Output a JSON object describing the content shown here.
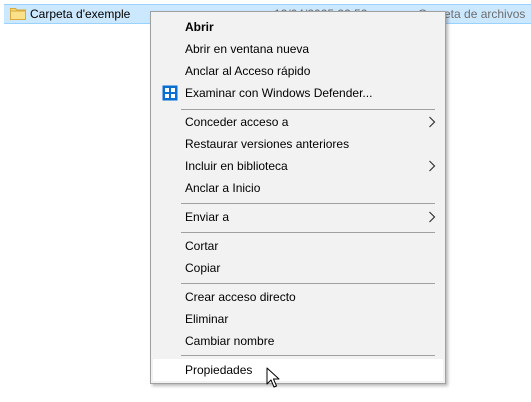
{
  "file_row": {
    "name": "Carpeta d'exemple",
    "date": "12/04/2025 22:52",
    "type": "Carpeta de archivos",
    "icon": "folder-icon"
  },
  "menu": {
    "open": "Abrir",
    "open_new_window": "Abrir en ventana nueva",
    "pin_quick_access": "Anclar al Acceso rápido",
    "scan_defender": "Examinar con Windows Defender...",
    "give_access": "Conceder acceso a",
    "restore_versions": "Restaurar versiones anteriores",
    "include_library": "Incluir en biblioteca",
    "pin_start": "Anclar a Inicio",
    "send_to": "Enviar a",
    "cut": "Cortar",
    "copy": "Copiar",
    "create_shortcut": "Crear acceso directo",
    "delete": "Eliminar",
    "rename": "Cambiar nombre",
    "properties": "Propiedades"
  },
  "icons": {
    "defender": "windows-defender-icon",
    "submenu": "chevron-right-icon",
    "cursor": "mouse-pointer-icon"
  },
  "colors": {
    "selection_bg": "#cce8ff",
    "menu_bg": "#f2f2f2",
    "menu_hover": "#ffffff",
    "defender_blue": "#0a6fd1"
  }
}
